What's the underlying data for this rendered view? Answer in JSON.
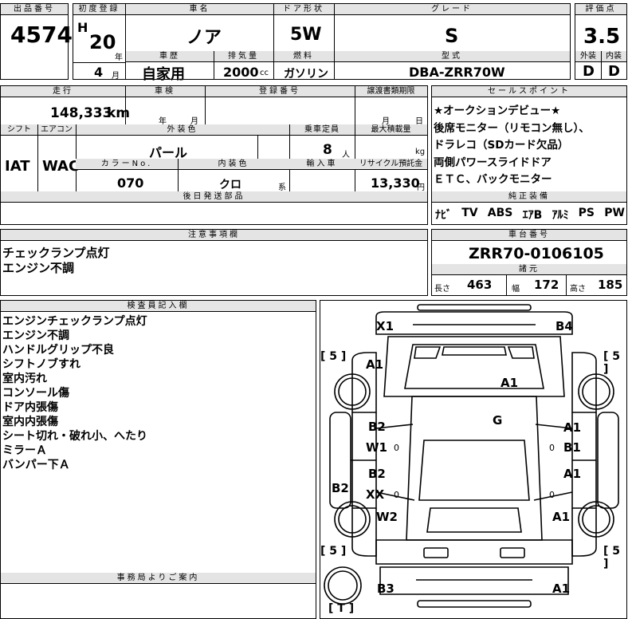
{
  "header": {
    "lot_label": "出品番号",
    "lot": "4574",
    "first_reg_label": "初度登録",
    "era": "H",
    "year": "20",
    "year_unit": "年",
    "month": "4",
    "month_unit": "月",
    "car_name_label": "車名",
    "car_name": "ノア",
    "door_label": "ドア形状",
    "door": "5W",
    "grade_label": "グレード",
    "grade": "S",
    "score_label": "評価点",
    "score": "3.5",
    "history_label": "車歴",
    "history": "自家用",
    "displacement_label": "排気量",
    "displacement": "2000",
    "displacement_unit": "cc",
    "fuel_label": "燃料",
    "fuel": "ガソリン",
    "model_label": "型式",
    "model": "DBA-ZRR70W",
    "exterior_label": "外装",
    "exterior": "D",
    "interior_label": "内装",
    "interior": "D"
  },
  "row2": {
    "mileage_label": "走行",
    "mileage": "148,333",
    "mileage_unit": "km",
    "inspection_label": "車検",
    "inspection_year_unit": "年",
    "inspection_month_unit": "月",
    "plate_label": "登録番号",
    "transfer_label": "譲渡書類期限",
    "transfer_month_unit": "月",
    "transfer_day_unit": "日",
    "shift_label": "シフト",
    "shift": "IAT",
    "ac_label": "エアコン",
    "ac": "WAC",
    "color_label": "外装色",
    "color": "パール",
    "capacity_label": "乗車定員",
    "capacity": "8",
    "capacity_unit": "人",
    "load_label": "最大積載量",
    "load_unit": "kg",
    "color_no_label": "カラーNo.",
    "color_no": "070",
    "int_color_label": "内装色",
    "int_color": "クロ",
    "int_color_unit": "系",
    "import_label": "輸入車",
    "recycle_label": "リサイクル預託金",
    "recycle": "13,330",
    "recycle_unit": "円",
    "later_label": "後日発送部品"
  },
  "sales_points": {
    "label": "セールスポイント",
    "lines": [
      "★オークションデビュー★",
      "後席モニター（リモコン無し）、",
      "ドラレコ（SDカード欠品）",
      "両側パワースライドドア",
      "ＥＴＣ、バックモニター"
    ]
  },
  "equipment": {
    "label": "純正装備",
    "items": [
      "ﾅﾋﾞ",
      "TV",
      "ABS",
      "ｴｱB",
      "ｱﾙﾐ",
      "PS",
      "PW"
    ]
  },
  "notes": {
    "label": "注意事項欄",
    "lines": [
      "チェックランプ点灯",
      "エンジン不調"
    ]
  },
  "chassis": {
    "label": "車台番号",
    "number": "ZRR70-0106105",
    "dims_label": "諸元",
    "length_label": "長さ",
    "length": "463",
    "width_label": "幅",
    "width": "172",
    "height_label": "高さ",
    "height": "185"
  },
  "inspector": {
    "label": "検査員記入欄",
    "lines": [
      "エンジンチェックランプ点灯",
      "エンジン不調",
      "ハンドルグリップ不良",
      "シフトノブすれ",
      "室内汚れ",
      "コンソール傷",
      "ドア内張傷",
      "室内内張傷",
      "シート切れ・破れ小、へたり",
      "ミラーＡ",
      "バンパー下Ａ"
    ]
  },
  "office": {
    "label": "事務局よりご案内"
  },
  "diagram": {
    "damage": {
      "x1": "X1",
      "b4": "B4",
      "a1_fl": "A1",
      "a1_hood": "A1",
      "g": "G",
      "b2_l1": "B2",
      "w1": "W1",
      "a1_r1": "A1",
      "b1": "B1",
      "b2_l2": "B2",
      "xx": "XX",
      "a1_r2": "A1",
      "b2_side": "B2",
      "w2": "W2",
      "a1_rr": "A1",
      "b3": "B3",
      "a1_rear": "A1"
    },
    "tires": {
      "fl": "[ 5 ]",
      "fr": "[ 5 ]",
      "rl": "[ 5 ]",
      "rr": "[ 5 ]",
      "spare": "[ T ]"
    },
    "zero_marks": "0"
  }
}
